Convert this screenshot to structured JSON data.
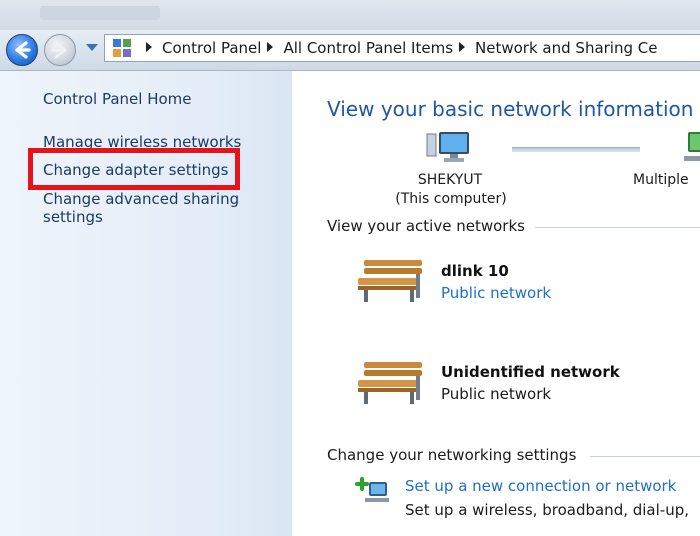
{
  "address_bar": {
    "crumbs": [
      "Control Panel",
      "All Control Panel Items",
      "Network and Sharing Ce"
    ]
  },
  "left_pane": {
    "home": "Control Panel Home",
    "wireless": "Manage wireless networks",
    "adapter": "Change adapter settings",
    "sharing": "Change advanced sharing settings"
  },
  "main": {
    "title": "View your basic network information",
    "computer": {
      "name": "SHEKYUT",
      "sub": "(This computer)"
    },
    "multiple_label": "Multiple",
    "active_heading": "View your active networks",
    "networks": [
      {
        "name": "dlink  10",
        "type": "Public network",
        "type_is_link": true
      },
      {
        "name": "Unidentified network",
        "type": "Public network",
        "type_is_link": false
      }
    ],
    "change_heading": "Change your networking settings",
    "setup_link": "Set up a new connection or network",
    "setup_desc": "Set up a wireless, broadband, dial-up,"
  },
  "colors": {
    "highlight": "#e8121a",
    "link": "#1f6fc6",
    "title": "#1f57a8"
  },
  "icons": [
    "back-arrow-icon",
    "forward-arrow-icon",
    "control-panel-icon",
    "computer-icon",
    "network-icon",
    "bench-icon",
    "new-connection-icon"
  ]
}
